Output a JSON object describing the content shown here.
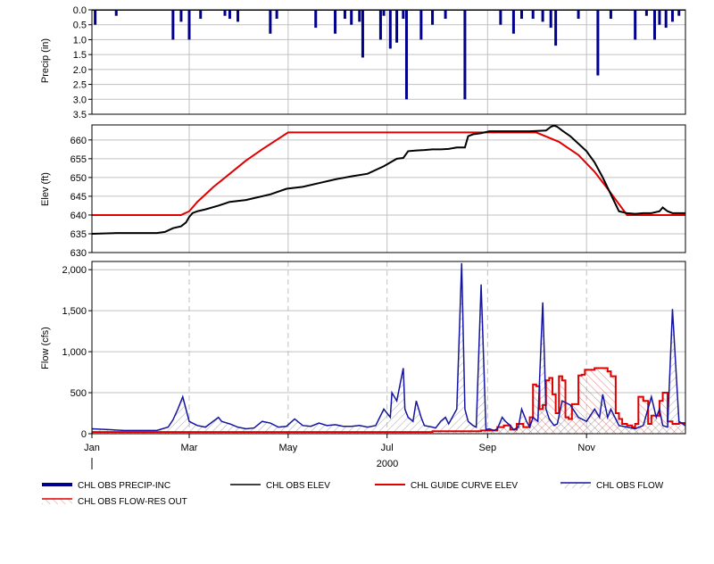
{
  "chart_data": {
    "type": "line",
    "year_label": "2000",
    "x_ticks": [
      "Jan",
      "Mar",
      "May",
      "Jul",
      "Sep",
      "Nov"
    ],
    "x_tick_days": [
      0,
      60,
      121,
      182,
      244,
      305
    ],
    "colors": {
      "precip": "#00008b",
      "elev": "#000000",
      "guide": "#e00000",
      "flow": "#1414a0",
      "grid": "#c0c0c0"
    },
    "panels": [
      {
        "ylabel": "Precip (in)",
        "ylim": [
          0,
          3.5
        ],
        "y_ticks": [
          "0.0",
          "0.5",
          "1.0",
          "1.5",
          "2.0",
          "2.5",
          "3.0",
          "3.5"
        ],
        "y_tick_values": [
          0,
          0.5,
          1.0,
          1.5,
          2.0,
          2.5,
          3.0,
          3.5
        ],
        "inverted": true,
        "grid": "solid"
      },
      {
        "ylabel": "Elev (ft)",
        "ylim": [
          630,
          664
        ],
        "y_ticks": [
          "630",
          "635",
          "640",
          "645",
          "650",
          "655",
          "660"
        ],
        "y_tick_values": [
          630,
          635,
          640,
          645,
          650,
          655,
          660
        ],
        "inverted": false,
        "grid": "solid"
      },
      {
        "ylabel": "Flow (cfs)",
        "ylim": [
          0,
          2100
        ],
        "y_ticks": [
          "0",
          "500",
          "1,000",
          "1,500",
          "2,000"
        ],
        "y_tick_values": [
          0,
          500,
          1000,
          1500,
          2000
        ],
        "inverted": false,
        "grid": "dashed"
      }
    ],
    "precip_series": {
      "name": "CHL OBS PRECIP-INC",
      "day": [
        2,
        15,
        50,
        55,
        60,
        67,
        82,
        85,
        90,
        110,
        114,
        138,
        150,
        156,
        160,
        165,
        167,
        178,
        180,
        184,
        188,
        192,
        194,
        203,
        210,
        218,
        230,
        252,
        260,
        265,
        272,
        278,
        283,
        286,
        300,
        312,
        320,
        335,
        342,
        347,
        350,
        354,
        358,
        362
      ],
      "value": [
        0.5,
        0.2,
        1.0,
        0.4,
        1.0,
        0.3,
        0.2,
        0.3,
        0.4,
        0.8,
        0.3,
        0.6,
        0.8,
        0.3,
        0.5,
        0.4,
        1.6,
        1.0,
        0.2,
        1.3,
        1.1,
        0.3,
        3.0,
        1.0,
        0.5,
        0.3,
        3.0,
        0.5,
        0.8,
        0.3,
        0.3,
        0.4,
        0.6,
        1.2,
        0.3,
        2.2,
        0.3,
        1.0,
        0.2,
        1.0,
        0.5,
        0.6,
        0.4,
        0.2
      ]
    },
    "elev_series": {
      "name": "CHL OBS ELEV",
      "day": [
        0,
        15,
        40,
        45,
        50,
        55,
        58,
        60,
        62,
        65,
        70,
        78,
        85,
        95,
        100,
        110,
        120,
        130,
        140,
        150,
        160,
        170,
        180,
        188,
        192,
        195,
        200,
        205,
        210,
        215,
        220,
        225,
        228,
        230,
        232,
        235,
        240,
        245,
        247,
        250,
        255,
        260,
        270,
        280,
        283,
        285,
        287,
        290,
        295,
        300,
        305,
        310,
        315,
        320,
        325,
        330,
        335,
        340,
        345,
        350,
        352,
        355,
        358,
        362,
        366
      ],
      "value": [
        635,
        635.2,
        635.2,
        635.5,
        636.5,
        637,
        638,
        639.5,
        640.5,
        641,
        641.5,
        642.5,
        643.5,
        644,
        644.5,
        645.5,
        647,
        647.5,
        648.5,
        649.5,
        650.3,
        651,
        653,
        655,
        655.2,
        657,
        657.2,
        657.3,
        657.5,
        657.5,
        657.6,
        658,
        658,
        658,
        661,
        661.5,
        661.8,
        662.3,
        662.3,
        662.3,
        662.3,
        662.3,
        662.3,
        662.5,
        663.5,
        663.8,
        663.5,
        662.5,
        661,
        659,
        657,
        654,
        650,
        645.5,
        641,
        640.5,
        640.3,
        640.5,
        640.5,
        641,
        642,
        641,
        640.5,
        640.5,
        640.5
      ]
    },
    "guide_series": {
      "name": "CHL GUIDE CURVE ELEV",
      "day": [
        0,
        55,
        60,
        65,
        75,
        85,
        95,
        105,
        121,
        274,
        288,
        300,
        310,
        318,
        330,
        366
      ],
      "value": [
        640,
        640,
        641,
        643.5,
        647.5,
        651,
        654.5,
        657.5,
        662,
        662,
        659.5,
        656,
        651.5,
        647,
        640,
        640
      ]
    },
    "flow_series": {
      "name": "CHL OBS FLOW",
      "day": [
        0,
        10,
        20,
        30,
        40,
        47,
        50,
        53,
        56,
        60,
        65,
        70,
        78,
        80,
        85,
        90,
        95,
        100,
        105,
        110,
        115,
        120,
        125,
        130,
        135,
        140,
        145,
        150,
        155,
        160,
        165,
        170,
        175,
        180,
        184,
        185,
        188,
        190,
        192,
        193,
        195,
        198,
        200,
        203,
        205,
        210,
        212,
        215,
        218,
        220,
        225,
        228,
        230,
        232,
        235,
        237,
        240,
        243,
        245,
        248,
        250,
        253,
        255,
        258,
        260,
        263,
        265,
        268,
        270,
        272,
        275,
        278,
        280,
        282,
        285,
        287,
        290,
        295,
        300,
        305,
        310,
        313,
        315,
        318,
        320,
        325,
        330,
        335,
        340,
        345,
        348,
        350,
        352,
        355,
        358,
        362,
        366
      ],
      "value": [
        60,
        50,
        40,
        40,
        40,
        80,
        170,
        300,
        450,
        150,
        100,
        80,
        200,
        150,
        120,
        80,
        60,
        70,
        150,
        130,
        80,
        90,
        180,
        100,
        90,
        130,
        100,
        110,
        90,
        90,
        100,
        80,
        100,
        300,
        200,
        500,
        400,
        600,
        800,
        300,
        200,
        150,
        400,
        200,
        100,
        80,
        70,
        150,
        200,
        120,
        300,
        2080,
        300,
        150,
        100,
        80,
        1820,
        50,
        60,
        40,
        60,
        200,
        150,
        100,
        50,
        80,
        300,
        150,
        80,
        200,
        150,
        1600,
        300,
        180,
        100,
        120,
        400,
        350,
        200,
        150,
        300,
        200,
        480,
        200,
        300,
        100,
        80,
        60,
        100,
        450,
        200,
        300,
        100,
        80,
        1520,
        150,
        100
      ]
    },
    "resout_series": {
      "name": "CHL OBS FLOW-RES OUT",
      "day": [
        0,
        180,
        210,
        240,
        250,
        254,
        258,
        262,
        266,
        270,
        272,
        274,
        276,
        278,
        280,
        282,
        284,
        286,
        288,
        290,
        292,
        294,
        296,
        298,
        300,
        302,
        304,
        310,
        318,
        320,
        323,
        325,
        327,
        330,
        333,
        335,
        337,
        340,
        343,
        345,
        350,
        352,
        355,
        358,
        362,
        366
      ],
      "value": [
        20,
        20,
        30,
        40,
        80,
        100,
        50,
        120,
        80,
        200,
        600,
        580,
        300,
        350,
        650,
        680,
        480,
        250,
        700,
        650,
        200,
        180,
        360,
        360,
        710,
        720,
        780,
        800,
        760,
        700,
        250,
        180,
        120,
        100,
        80,
        120,
        450,
        400,
        120,
        220,
        400,
        500,
        150,
        120,
        130,
        130
      ]
    },
    "legend": [
      {
        "label": "CHL OBS PRECIP-INC",
        "style": "thick-bar"
      },
      {
        "label": "CHL OBS ELEV",
        "style": "black-line"
      },
      {
        "label": "CHL GUIDE CURVE ELEV",
        "style": "red-line"
      },
      {
        "label": "CHL OBS FLOW",
        "style": "blue-hatch"
      },
      {
        "label": "CHL OBS FLOW-RES OUT",
        "style": "red-hatch"
      }
    ]
  }
}
